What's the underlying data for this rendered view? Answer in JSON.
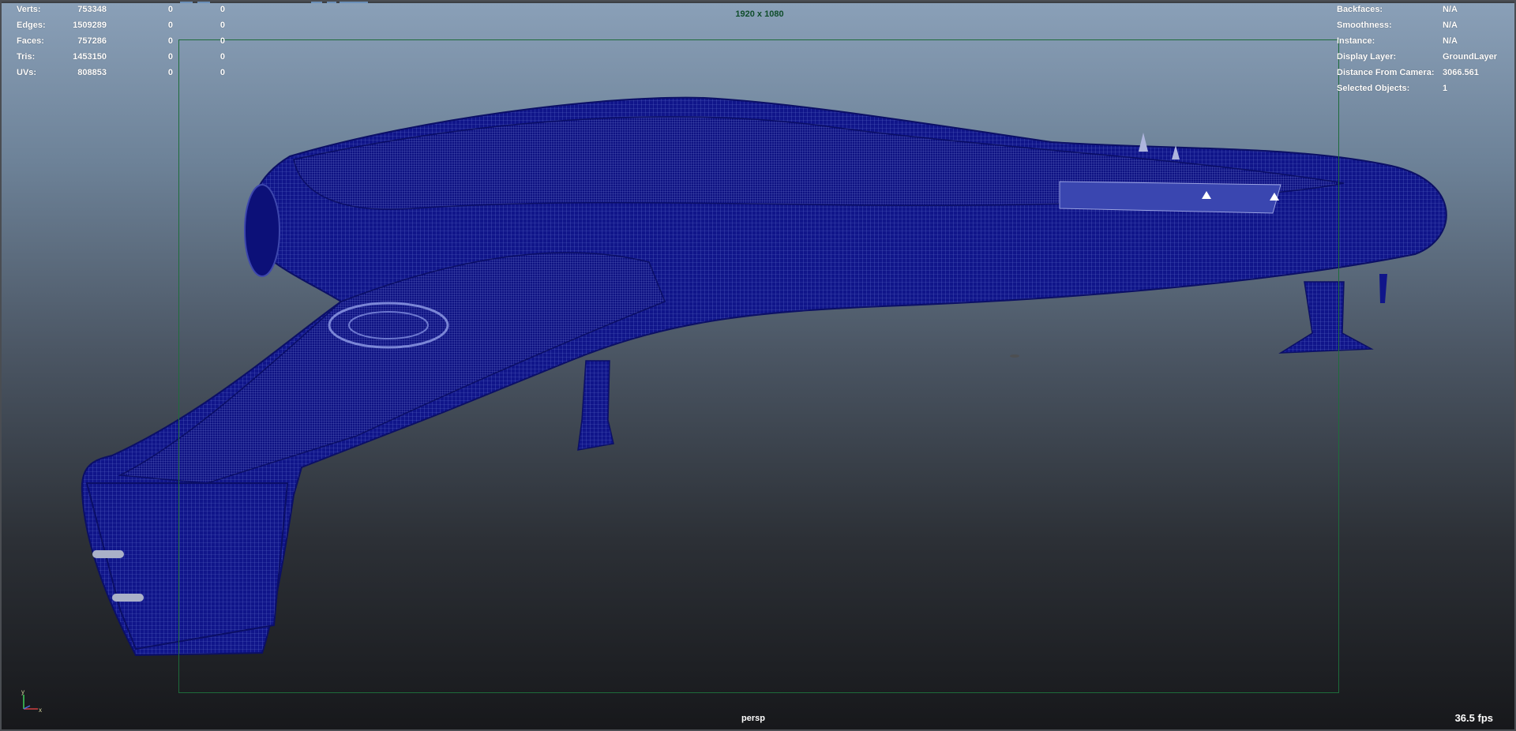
{
  "hud_left": {
    "rows": [
      {
        "label": "Verts:",
        "total": "753348",
        "selected": "0",
        "components": "0"
      },
      {
        "label": "Edges:",
        "total": "1509289",
        "selected": "0",
        "components": "0"
      },
      {
        "label": "Faces:",
        "total": "757286",
        "selected": "0",
        "components": "0"
      },
      {
        "label": "Tris:",
        "total": "1453150",
        "selected": "0",
        "components": "0"
      },
      {
        "label": "UVs:",
        "total": "808853",
        "selected": "0",
        "components": "0"
      }
    ]
  },
  "hud_right": {
    "rows": [
      {
        "label": "Backfaces:",
        "value": "N/A"
      },
      {
        "label": "Smoothness:",
        "value": "N/A"
      },
      {
        "label": "Instance:",
        "value": "N/A"
      },
      {
        "label": "Display Layer:",
        "value": "GroundLayer"
      },
      {
        "label": "Distance From Camera:",
        "value": "3066.561"
      },
      {
        "label": "Selected Objects:",
        "value": "1"
      }
    ]
  },
  "resolution_gate": {
    "label": "1920 x 1080"
  },
  "camera": {
    "name": "persp"
  },
  "performance": {
    "fps": "36.5 fps"
  },
  "axis_indicator": {
    "y_label": "y",
    "x_label": "x"
  },
  "colors": {
    "wireframe": "#10158a",
    "resolution_gate": "#1e6b3b",
    "hud_text": "#ffffff"
  }
}
